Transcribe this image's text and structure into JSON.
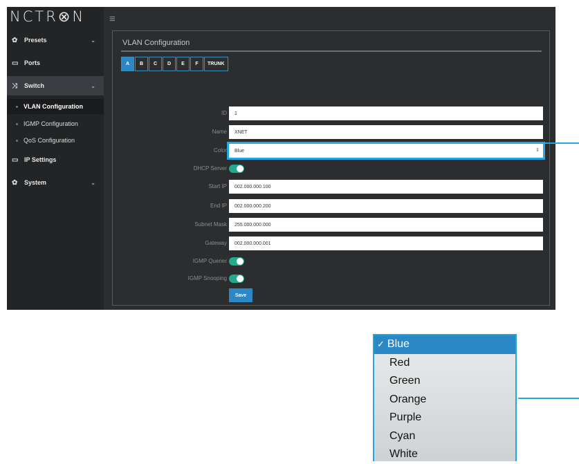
{
  "app": {
    "logo_text": "NCTR⊗N",
    "menu_icon": "hamburger-icon"
  },
  "sidebar": {
    "items": [
      {
        "label": "Presets",
        "icon": "gear-icon"
      },
      {
        "label": "Ports",
        "icon": "monitor-icon"
      },
      {
        "label": "Switch",
        "icon": "shuffle-icon"
      },
      {
        "label": "IP Settings",
        "icon": "monitor-icon"
      },
      {
        "label": "System",
        "icon": "gear-icon"
      }
    ],
    "sub_items": [
      {
        "label": "VLAN Configuration"
      },
      {
        "label": "IGMP Configuration"
      },
      {
        "label": "QoS Configuration"
      }
    ]
  },
  "panel": {
    "title": "VLAN Configuration",
    "tabs": [
      "A",
      "B",
      "C",
      "D",
      "E",
      "F",
      "TRUNK"
    ],
    "fields": {
      "id": {
        "label": "ID",
        "value": "1"
      },
      "name": {
        "label": "Name",
        "value": "XNET"
      },
      "color": {
        "label": "Color",
        "value": "Blue"
      },
      "dhcp": {
        "label": "DHCP Server"
      },
      "start_ip": {
        "label": "Start IP",
        "value": "002.000.000.100"
      },
      "end_ip": {
        "label": "End IP",
        "value": "002.000.000.200"
      },
      "subnet": {
        "label": "Subnet Mask",
        "value": "255.000.000.000"
      },
      "gateway": {
        "label": "Gateway",
        "value": "002.000.000.001"
      },
      "igmp_querier": {
        "label": "IGMP Querier"
      },
      "igmp_snooping": {
        "label": "IGMP Snooping"
      }
    },
    "save_label": "Save"
  },
  "dropdown": {
    "check": "✓",
    "options": [
      "Blue",
      "Red",
      "Green",
      "Orange",
      "Purple",
      "Cyan",
      "White"
    ]
  },
  "colors": {
    "accent": "#2c87c6",
    "callout": "#23a7e0",
    "toggle_on": "#25a98d"
  }
}
